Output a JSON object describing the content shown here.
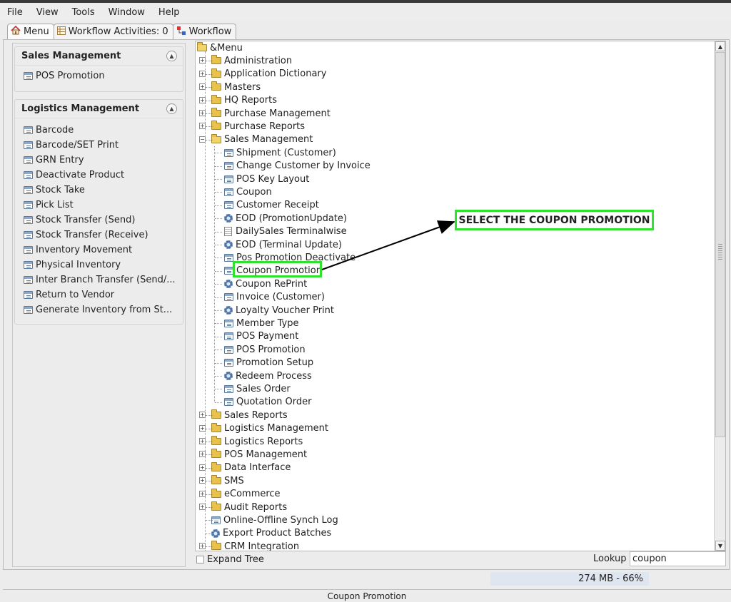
{
  "menubar": {
    "items": [
      "File",
      "View",
      "Tools",
      "Window",
      "Help"
    ]
  },
  "tabs": [
    {
      "label": "Menu",
      "icon": "home-icon"
    },
    {
      "label": "Workflow Activities: 0",
      "icon": "table-icon"
    },
    {
      "label": "Workflow",
      "icon": "workflow-icon"
    }
  ],
  "left": {
    "sales": {
      "title": "Sales Management",
      "items": [
        "POS Promotion"
      ]
    },
    "logistics": {
      "title": "Logistics Management",
      "items": [
        "Barcode",
        "Barcode/SET Print",
        "GRN Entry",
        "Deactivate Product",
        "Stock Take",
        "Pick List",
        "Stock Transfer (Send)",
        "Stock Transfer (Receive)",
        "Inventory Movement",
        "Physical Inventory",
        "Inter Branch Transfer (Send/...",
        "Return to Vendor",
        "Generate Inventory from St..."
      ]
    }
  },
  "tree": {
    "root": "&Menu",
    "top": [
      "Administration",
      "Application Dictionary",
      "Masters",
      "HQ Reports",
      "Purchase Management",
      "Purchase Reports",
      "Sales Management"
    ],
    "sales_children": [
      {
        "label": "Shipment (Customer)",
        "icon": "window-icon"
      },
      {
        "label": "Change Customer by Invoice",
        "icon": "window-icon"
      },
      {
        "label": "POS Key Layout",
        "icon": "window-icon"
      },
      {
        "label": "Coupon",
        "icon": "window-icon"
      },
      {
        "label": "Customer Receipt",
        "icon": "window-icon"
      },
      {
        "label": "EOD (PromotionUpdate)",
        "icon": "process-icon"
      },
      {
        "label": "DailySales Terminalwise",
        "icon": "report-icon"
      },
      {
        "label": "EOD (Terminal Update)",
        "icon": "process-icon"
      },
      {
        "label": "Pos Promotion Deactivate",
        "icon": "window-icon"
      },
      {
        "label": "Coupon Promotion",
        "icon": "window-icon"
      },
      {
        "label": "Coupon RePrint",
        "icon": "process-icon"
      },
      {
        "label": "Invoice (Customer)",
        "icon": "window-icon"
      },
      {
        "label": "Loyalty Voucher Print",
        "icon": "process-icon"
      },
      {
        "label": "Member Type",
        "icon": "window-icon"
      },
      {
        "label": "POS Payment",
        "icon": "window-icon"
      },
      {
        "label": "POS Promotion",
        "icon": "window-icon"
      },
      {
        "label": "Promotion Setup",
        "icon": "window-icon"
      },
      {
        "label": "Redeem Process",
        "icon": "process-icon"
      },
      {
        "label": "Sales Order",
        "icon": "window-icon"
      },
      {
        "label": "Quotation Order",
        "icon": "window-icon"
      }
    ],
    "bottom": [
      {
        "label": "Sales Reports",
        "type": "folder"
      },
      {
        "label": "Logistics Management",
        "type": "folder"
      },
      {
        "label": "Logistics Reports",
        "type": "folder"
      },
      {
        "label": "POS Management",
        "type": "folder"
      },
      {
        "label": "Data Interface",
        "type": "folder"
      },
      {
        "label": "SMS",
        "type": "folder"
      },
      {
        "label": "eCommerce",
        "type": "folder"
      },
      {
        "label": "Audit Reports",
        "type": "folder"
      },
      {
        "label": "Online-Offline Synch Log",
        "type": "window"
      },
      {
        "label": "Export Product Batches",
        "type": "process"
      },
      {
        "label": "CRM Integration",
        "type": "folder"
      }
    ],
    "selected": "Coupon Promotion"
  },
  "annotation": {
    "text": "SELECT THE COUPON PROMOTION",
    "color": "#2ee22e"
  },
  "footer": {
    "expand_tree": "Expand Tree",
    "lookup_label": "Lookup",
    "lookup_value": "coupon"
  },
  "memory": "274 MB - 66%",
  "status": "Coupon Promotion"
}
